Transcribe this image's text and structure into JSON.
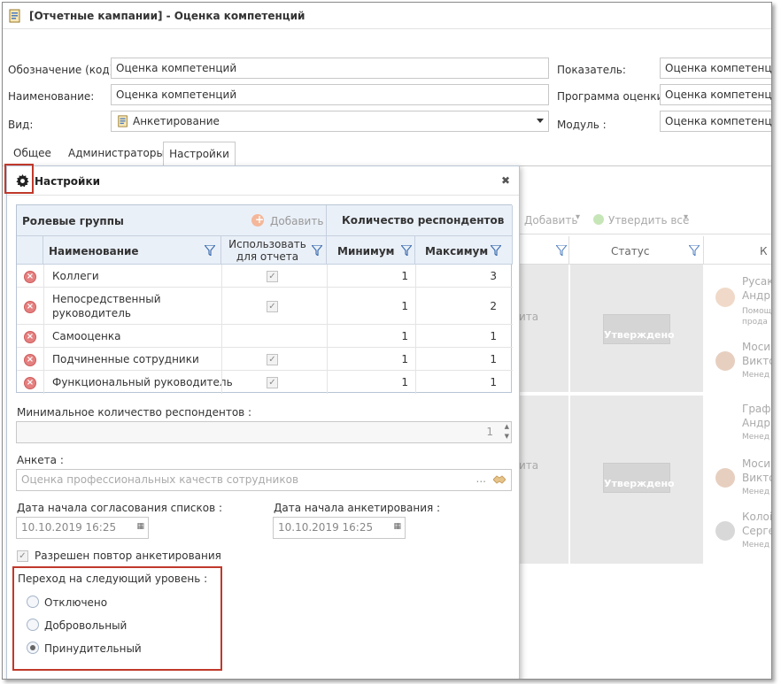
{
  "window": {
    "title": "[Отчетные кампании] - Оценка компетенций"
  },
  "form": {
    "code_label": "Обозначение (код):",
    "code_value": "Оценка компетенций",
    "name_label": "Наименование:",
    "name_value": "Оценка компетенций",
    "type_label": "Вид:",
    "type_value": "Анкетирование",
    "indicator_label": "Показатель:",
    "indicator_value": "Оценка компетенций",
    "program_label": "Программа оценки :",
    "program_value": "Оценка компетенций",
    "module_label": "Модуль :",
    "module_value": "Оценка компетенций"
  },
  "tabs": [
    "Общее",
    "Администраторы",
    "Настройки"
  ],
  "background": {
    "add_label": "Добавить",
    "approve_all_label": "Утвердить все",
    "status_header": "Статус",
    "col_k": "К",
    "approved_1": "Утверждено",
    "approved_2": "Утверждено",
    "partial_1": "ита",
    "partial_2": "ита",
    "people": [
      {
        "name1": "Русак",
        "name2": "Андр",
        "role1": "Помощ",
        "role2": "прода"
      },
      {
        "name1": "Моси",
        "name2": "Викто",
        "role1": "Менед",
        "role2": ""
      },
      {
        "name1": "Графо",
        "name2": "Андр",
        "role1": "Менед",
        "role2": ""
      },
      {
        "name1": "Моси",
        "name2": "Викто",
        "role1": "Менед",
        "role2": ""
      },
      {
        "name1": "Колоі",
        "name2": "Серге",
        "role1": "Менед",
        "role2": ""
      }
    ]
  },
  "popup": {
    "title": "Настройки",
    "role_groups_title": "Ролевые группы",
    "add_label": "Добавить",
    "respondents_title": "Количество респондентов",
    "col_name": "Наименование",
    "col_use_line1": "Использовать",
    "col_use_line2": "для отчета",
    "col_min": "Минимум",
    "col_max": "Максимум",
    "rows": [
      {
        "name_line1": "Коллеги",
        "name_line2": "",
        "use": true,
        "min": "1",
        "max": "3"
      },
      {
        "name_line1": "Непосредственный",
        "name_line2": "руководитель",
        "use": true,
        "min": "1",
        "max": "2"
      },
      {
        "name_line1": "Самооценка",
        "name_line2": "",
        "use": false,
        "min": "1",
        "max": "1"
      },
      {
        "name_line1": "Подчиненные сотрудники",
        "name_line2": "",
        "use": true,
        "min": "1",
        "max": "1"
      },
      {
        "name_line1": "Функциональный руководитель",
        "name_line2": "",
        "use": true,
        "min": "1",
        "max": "1"
      }
    ],
    "min_respondents_label": "Минимальное количество респондентов :",
    "min_respondents_value": "1",
    "questionnaire_label": "Анкета :",
    "questionnaire_value": "Оценка профессиональных качеств сотрудников",
    "questionnaire_ellipsis": "...",
    "list_start_label": "Дата начала согласования списков :",
    "list_start_value": "10.10.2019 16:25",
    "survey_start_label": "Дата начала анкетирования :",
    "survey_start_value": "10.10.2019 16:25",
    "repeat_label": "Разрешен повтор анкетирования",
    "transition_label": "Переход на следующий уровень :",
    "options": [
      "Отключено",
      "Добровольный",
      "Принудительный"
    ],
    "selected_option": "Принудительный"
  },
  "colors": {
    "highlight_red": "#c0392b",
    "header_blue": "#eaf0f8",
    "border_blue": "#b8c4d4"
  }
}
